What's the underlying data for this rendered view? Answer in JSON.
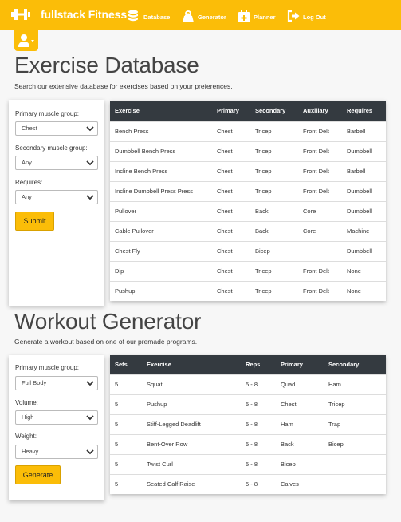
{
  "navbar": {
    "brand": "fullstack Fitness",
    "brand_icon": "dumbbell-icon",
    "items": [
      {
        "label": "Database",
        "icon": "database-icon"
      },
      {
        "label": "Generator",
        "icon": "kettlebell-icon"
      },
      {
        "label": "Planner",
        "icon": "calendar-plus-icon"
      },
      {
        "label": "Log Out",
        "icon": "sign-out-icon"
      }
    ],
    "user_icon": "user-icon",
    "accent": "#fbbd08"
  },
  "database": {
    "title": "Exercise Database",
    "subtitle": "Search our extensive database for exercises based on your preferences.",
    "form": {
      "primary_label": "Primary muscle group:",
      "primary_value": "Chest",
      "secondary_label": "Secondary muscle group:",
      "secondary_value": "Any",
      "requires_label": "Requires:",
      "requires_value": "Any",
      "submit_label": "Submit"
    },
    "table": {
      "headers": [
        "Exercise",
        "Primary",
        "Secondary",
        "Auxillary",
        "Requires"
      ],
      "rows": [
        [
          "Bench Press",
          "Chest",
          "Tricep",
          "Front Delt",
          "Barbell"
        ],
        [
          "Dumbbell Bench Press",
          "Chest",
          "Tricep",
          "Front Delt",
          "Dumbbell"
        ],
        [
          "Incline Bench Press",
          "Chest",
          "Tricep",
          "Front Delt",
          "Barbell"
        ],
        [
          "Incline Dumbbell Press Press",
          "Chest",
          "Tricep",
          "Front Delt",
          "Dumbbell"
        ],
        [
          "Pullover",
          "Chest",
          "Back",
          "Core",
          "Dumbbell"
        ],
        [
          "Cable Pullover",
          "Chest",
          "Back",
          "Core",
          "Machine"
        ],
        [
          "Chest Fly",
          "Chest",
          "Bicep",
          "",
          "Dumbbell"
        ],
        [
          "Dip",
          "Chest",
          "Tricep",
          "Front Delt",
          "None"
        ],
        [
          "Pushup",
          "Chest",
          "Tricep",
          "Front Delt",
          "None"
        ]
      ]
    }
  },
  "generator": {
    "title": "Workout Generator",
    "subtitle": "Generate a workout based on one of our premade programs.",
    "form": {
      "primary_label": "Primary muscle group:",
      "primary_value": "Full Body",
      "volume_label": "Volume:",
      "volume_value": "High",
      "weight_label": "Weight:",
      "weight_value": "Heavy",
      "generate_label": "Generate"
    },
    "table": {
      "headers": [
        "Sets",
        "Exercise",
        "Reps",
        "Primary",
        "Secondary"
      ],
      "rows": [
        [
          "5",
          "Squat",
          "5 - 8",
          "Quad",
          "Ham"
        ],
        [
          "5",
          "Pushup",
          "5 - 8",
          "Chest",
          "Tricep"
        ],
        [
          "5",
          "Stiff-Legged Deadlift",
          "5 - 8",
          "Ham",
          "Trap"
        ],
        [
          "5",
          "Bent-Over Row",
          "5 - 8",
          "Back",
          "Bicep"
        ],
        [
          "5",
          "Twist Curl",
          "5 - 8",
          "Bicep",
          ""
        ],
        [
          "5",
          "Seated Calf Raise",
          "5 - 8",
          "Calves",
          ""
        ]
      ]
    }
  }
}
